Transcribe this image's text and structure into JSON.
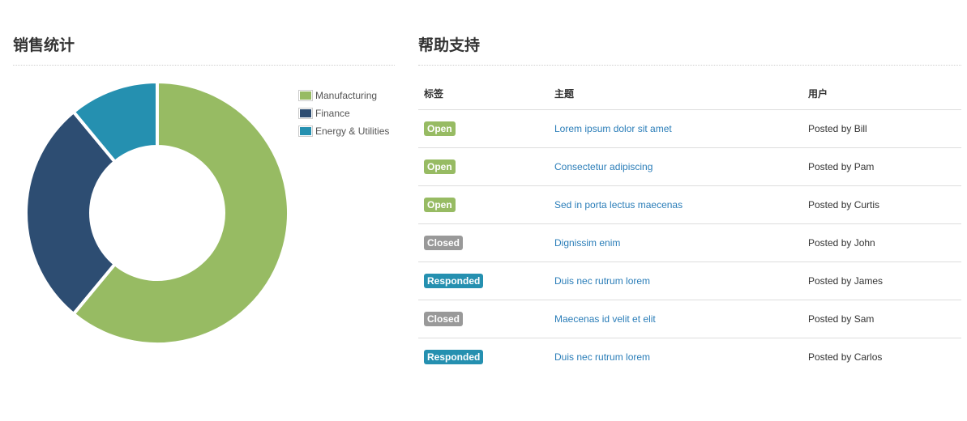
{
  "sales": {
    "title": "销售统计",
    "chart_data": {
      "type": "pie",
      "donut": true,
      "categories": [
        "Manufacturing",
        "Finance",
        "Energy & Utilities"
      ],
      "values": [
        61,
        28,
        11
      ],
      "colors": [
        "#97bb63",
        "#2d4d72",
        "#2590b0"
      ],
      "legend_position": "top-right"
    }
  },
  "support": {
    "title": "帮助支持",
    "headers": [
      "标签",
      "主题",
      "用户"
    ],
    "rows": [
      {
        "tag": "Open",
        "tag_color": "#97bb63",
        "subject": "Lorem ipsum dolor sit amet",
        "user": "Posted by Bill"
      },
      {
        "tag": "Open",
        "tag_color": "#97bb63",
        "subject": "Consectetur adipiscing",
        "user": "Posted by Pam"
      },
      {
        "tag": "Open",
        "tag_color": "#97bb63",
        "subject": "Sed in porta lectus maecenas",
        "user": "Posted by Curtis"
      },
      {
        "tag": "Closed",
        "tag_color": "#999999",
        "subject": "Dignissim enim",
        "user": "Posted by John"
      },
      {
        "tag": "Responded",
        "tag_color": "#2590b0",
        "subject": "Duis nec rutrum lorem",
        "user": "Posted by James"
      },
      {
        "tag": "Closed",
        "tag_color": "#999999",
        "subject": "Maecenas id velit et elit",
        "user": "Posted by Sam"
      },
      {
        "tag": "Responded",
        "tag_color": "#2590b0",
        "subject": "Duis nec rutrum lorem",
        "user": "Posted by Carlos"
      }
    ]
  }
}
